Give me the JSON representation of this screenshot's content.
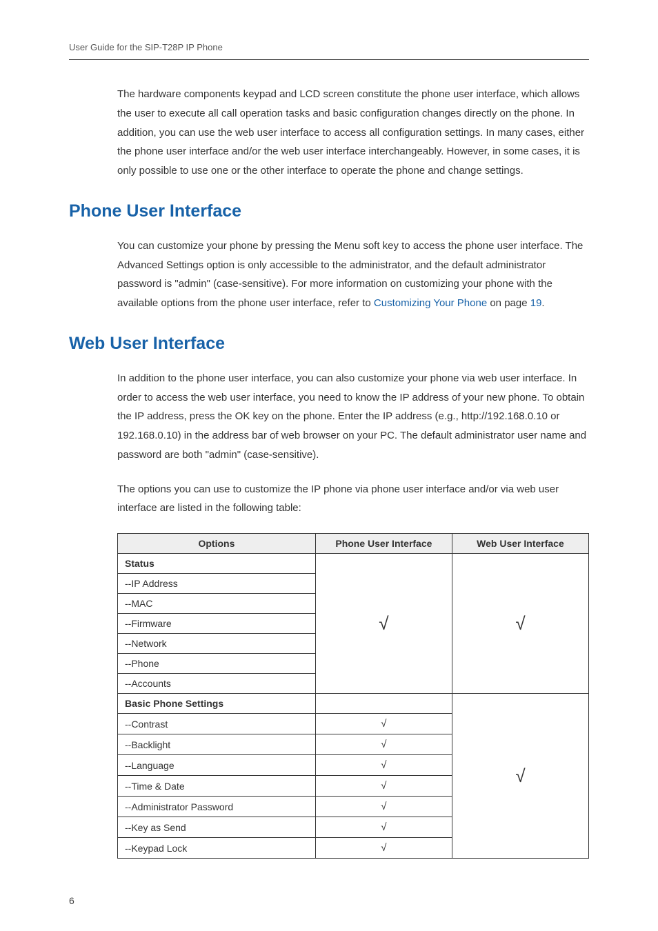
{
  "header": {
    "title": "User Guide for the SIP-T28P IP Phone"
  },
  "intro": {
    "p1": "The hardware components keypad and LCD screen constitute the phone user interface, which allows the user to execute all call operation tasks and basic configuration changes directly on the phone. In addition, you can use the web user interface to access all configuration settings. In many cases, either the phone user interface and/or the web user interface interchangeably. However, in some cases, it is only possible to use one or the other interface to operate the phone and change settings."
  },
  "sections": {
    "phone_ui": {
      "heading": "Phone User Interface",
      "p1_prefix": "You can customize your phone by pressing the Menu soft key to access the phone user interface. The Advanced Settings option is only accessible to the administrator, and the default administrator password is \"admin\" (case-sensitive). For more information on customizing your phone with the available options from the phone user interface, refer to ",
      "link_text": "Customizing Your Phone",
      "p1_mid": " on page ",
      "page_ref": "19",
      "p1_suffix": "."
    },
    "web_ui": {
      "heading": "Web User Interface",
      "p1": "In addition to the phone user interface, you can also customize your phone via web user interface. In order to access the web user interface, you need to know the IP address of your new phone. To obtain the IP address, press the OK key on the phone. Enter the IP address (e.g., http://192.168.0.10 or 192.168.0.10) in the address bar of web browser on your PC. The default administrator user name and password are both \"admin\" (case-sensitive).",
      "p2": "The options you can use to customize the IP phone via phone user interface and/or via web user interface are listed in the following table:"
    }
  },
  "table": {
    "headers": {
      "options": "Options",
      "phone": "Phone User Interface",
      "web": "Web User Interface"
    },
    "group1": {
      "title": "Status",
      "rows": [
        "--IP Address",
        "--MAC",
        "--Firmware",
        "--Network",
        "--Phone",
        "--Accounts"
      ],
      "phone_check": "√",
      "web_check": "√"
    },
    "group2": {
      "title": "Basic Phone Settings",
      "rows": [
        {
          "opt": "--Contrast",
          "phone": "√"
        },
        {
          "opt": "--Backlight",
          "phone": "√"
        },
        {
          "opt": "--Language",
          "phone": "√"
        },
        {
          "opt": "--Time & Date",
          "phone": "√"
        },
        {
          "opt": "--Administrator Password",
          "phone": "√"
        },
        {
          "opt": "--Key as Send",
          "phone": "√"
        },
        {
          "opt": "--Keypad Lock",
          "phone": "√"
        }
      ],
      "web_check": "√"
    }
  },
  "page_number": "6"
}
